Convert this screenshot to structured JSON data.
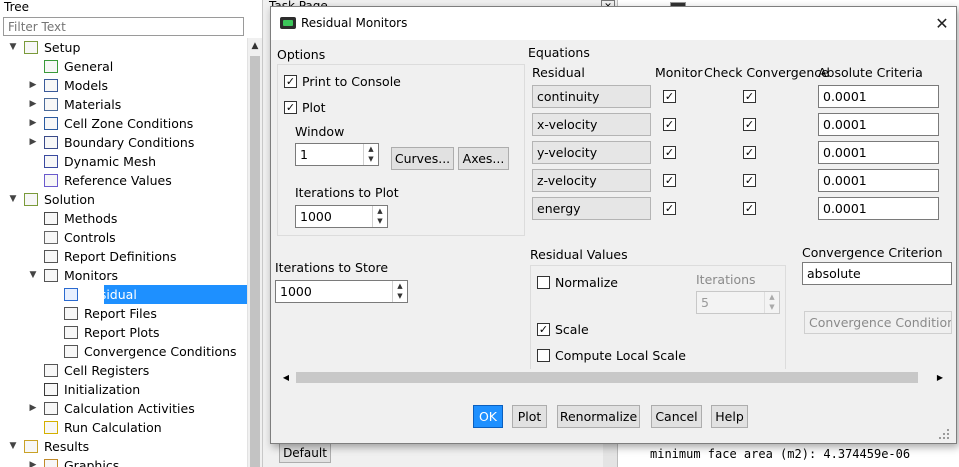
{
  "tree": {
    "title": "Tree",
    "filter_placeholder": "Filter Text",
    "items": [
      {
        "label": "Setup",
        "level": 0,
        "expander": "expanded",
        "icon": "setup-icon"
      },
      {
        "label": "General",
        "level": 1,
        "expander": "none",
        "icon": "general-icon"
      },
      {
        "label": "Models",
        "level": 1,
        "expander": "collapsed",
        "icon": "models-icon"
      },
      {
        "label": "Materials",
        "level": 1,
        "expander": "collapsed",
        "icon": "materials-icon"
      },
      {
        "label": "Cell Zone Conditions",
        "level": 1,
        "expander": "collapsed",
        "icon": "cell-zone-icon"
      },
      {
        "label": "Boundary Conditions",
        "level": 1,
        "expander": "collapsed",
        "icon": "boundary-icon"
      },
      {
        "label": "Dynamic Mesh",
        "level": 1,
        "expander": "none",
        "icon": "dynamic-mesh-icon"
      },
      {
        "label": "Reference Values",
        "level": 1,
        "expander": "none",
        "icon": "reference-values-icon"
      },
      {
        "label": "Solution",
        "level": 0,
        "expander": "expanded",
        "icon": "solution-icon"
      },
      {
        "label": "Methods",
        "level": 1,
        "expander": "none",
        "icon": "methods-icon"
      },
      {
        "label": "Controls",
        "level": 1,
        "expander": "none",
        "icon": "controls-icon"
      },
      {
        "label": "Report Definitions",
        "level": 1,
        "expander": "none",
        "icon": "report-definitions-icon"
      },
      {
        "label": "Monitors",
        "level": 1,
        "expander": "expanded",
        "icon": "monitors-icon"
      },
      {
        "label": "Residual",
        "level": 2,
        "expander": "none",
        "icon": "residual-icon",
        "selected": true
      },
      {
        "label": "Report Files",
        "level": 2,
        "expander": "none",
        "icon": "report-files-icon"
      },
      {
        "label": "Report Plots",
        "level": 2,
        "expander": "none",
        "icon": "report-plots-icon"
      },
      {
        "label": "Convergence Conditions",
        "level": 2,
        "expander": "none",
        "icon": "convergence-conditions-icon"
      },
      {
        "label": "Cell Registers",
        "level": 1,
        "expander": "none",
        "icon": "cell-registers-icon"
      },
      {
        "label": "Initialization",
        "level": 1,
        "expander": "none",
        "icon": "initialization-icon"
      },
      {
        "label": "Calculation Activities",
        "level": 1,
        "expander": "collapsed",
        "icon": "calculation-activities-icon"
      },
      {
        "label": "Run Calculation",
        "level": 1,
        "expander": "none",
        "icon": "run-calculation-icon"
      },
      {
        "label": "Results",
        "level": 0,
        "expander": "expanded",
        "icon": "results-icon"
      },
      {
        "label": "Graphics",
        "level": 1,
        "expander": "collapsed",
        "icon": "graphics-icon"
      }
    ]
  },
  "task_page": {
    "title": "Task Page",
    "default_button": "Default"
  },
  "console": {
    "line": "minimum face area (m2): 4.374459e-06"
  },
  "dialog": {
    "title": "Residual Monitors",
    "options": {
      "heading": "Options",
      "print_to_console": {
        "label": "Print to Console",
        "checked": true
      },
      "plot": {
        "label": "Plot",
        "checked": true
      },
      "window_label": "Window",
      "window_value": "1",
      "curves_button": "Curves...",
      "axes_button": "Axes...",
      "iterations_to_plot_label": "Iterations to Plot",
      "iterations_to_plot_value": "1000"
    },
    "iterations_to_store_label": "Iterations to Store",
    "iterations_to_store_value": "1000",
    "equations": {
      "heading": "Equations",
      "col_residual": "Residual",
      "col_monitor": "Monitor",
      "col_check": "Check Convergence",
      "col_abs": "Absolute Criteria",
      "rows": [
        {
          "name": "continuity",
          "monitor": true,
          "check": true,
          "criteria": "0.0001"
        },
        {
          "name": "x-velocity",
          "monitor": true,
          "check": true,
          "criteria": "0.0001"
        },
        {
          "name": "y-velocity",
          "monitor": true,
          "check": true,
          "criteria": "0.0001"
        },
        {
          "name": "z-velocity",
          "monitor": true,
          "check": true,
          "criteria": "0.0001"
        },
        {
          "name": "energy",
          "monitor": true,
          "check": true,
          "criteria": "0.0001"
        }
      ]
    },
    "residual_values": {
      "heading": "Residual Values",
      "normalize": {
        "label": "Normalize",
        "checked": false
      },
      "iterations_label": "Iterations",
      "iterations_value": "5",
      "scale": {
        "label": "Scale",
        "checked": true
      },
      "compute_local_scale": {
        "label": "Compute Local Scale",
        "checked": false
      }
    },
    "convergence": {
      "heading": "Convergence Criterion",
      "value": "absolute",
      "conditions_button": "Convergence Conditions..."
    },
    "buttons": {
      "ok": "OK",
      "plot": "Plot",
      "renormalize": "Renormalize",
      "cancel": "Cancel",
      "help": "Help"
    },
    "colors": {
      "selection": "#1e90ff",
      "ok_button": "#1e90ff"
    }
  }
}
